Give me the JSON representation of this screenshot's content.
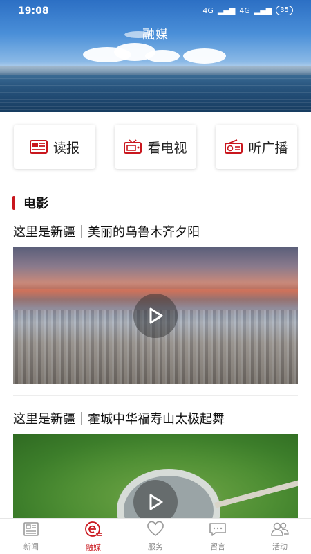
{
  "status": {
    "time": "19:08",
    "signal1": "4G",
    "signal2": "4G",
    "battery": "35"
  },
  "header": {
    "title": "融媒"
  },
  "quick_actions": [
    {
      "label": "读报",
      "icon": "newspaper-icon"
    },
    {
      "label": "看电视",
      "icon": "tv-icon"
    },
    {
      "label": "听广播",
      "icon": "radio-icon"
    }
  ],
  "section": {
    "title": "电影"
  },
  "videos": [
    {
      "title": "这里是新疆｜美丽的乌鲁木齐夕阳"
    },
    {
      "title": "这里是新疆｜霍城中华福寿山太极起舞"
    }
  ],
  "tabs": [
    {
      "label": "新闻",
      "icon": "news-icon",
      "active": false
    },
    {
      "label": "融媒",
      "icon": "media-icon",
      "active": true
    },
    {
      "label": "服务",
      "icon": "heart-icon",
      "active": false
    },
    {
      "label": "留言",
      "icon": "message-icon",
      "active": false
    },
    {
      "label": "活动",
      "icon": "people-icon",
      "active": false
    }
  ],
  "colors": {
    "accent": "#c9171e",
    "text": "#111111",
    "muted": "#888888"
  }
}
